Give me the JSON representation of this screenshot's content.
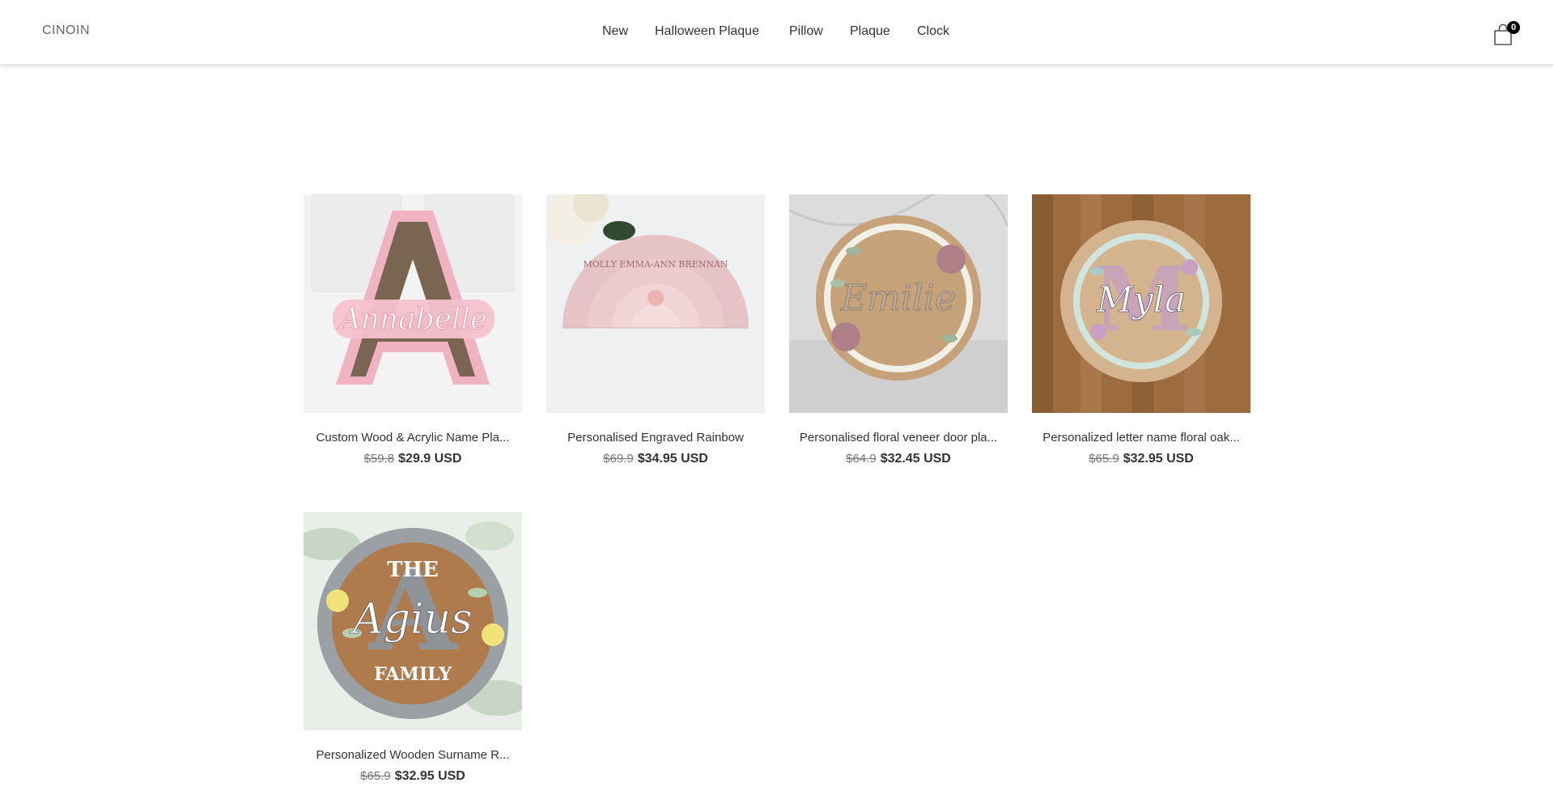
{
  "header": {
    "logo": "CINOIN",
    "nav": [
      "New",
      "Halloween Plaque",
      "Pillow",
      "Plaque",
      "Clock"
    ],
    "cart_count": "0"
  },
  "colors": {
    "header_bg": "#ffffff",
    "text": "#333333",
    "badge_bg": "#000000"
  },
  "products": [
    {
      "title": "Custom Wood & Acrylic Name Pla...",
      "old_price": "$59.8",
      "price": "$29.9 USD",
      "image_text": "Annabelle",
      "icon": "letter-a-name-plaque-image"
    },
    {
      "title": "Personalised Engraved Rainbow",
      "old_price": "$69.9",
      "price": "$34.95 USD",
      "image_text": "MOLLY EMMA-ANN BRENNAN",
      "icon": "rainbow-plaque-image"
    },
    {
      "title": "Personalised floral veneer door pla...",
      "old_price": "$64.9",
      "price": "$32.45 USD",
      "image_text": "Emilie",
      "icon": "floral-door-plaque-image"
    },
    {
      "title": "Personalized letter name floral oak...",
      "old_price": "$65.9",
      "price": "$32.95 USD",
      "image_text": "Myla",
      "icon": "floral-oak-letter-plaque-image"
    },
    {
      "title": "Personalized Wooden Surname R...",
      "old_price": "$65.9",
      "price": "$32.95 USD",
      "image_text": "Agius",
      "icon": "surname-family-sign-image"
    }
  ]
}
